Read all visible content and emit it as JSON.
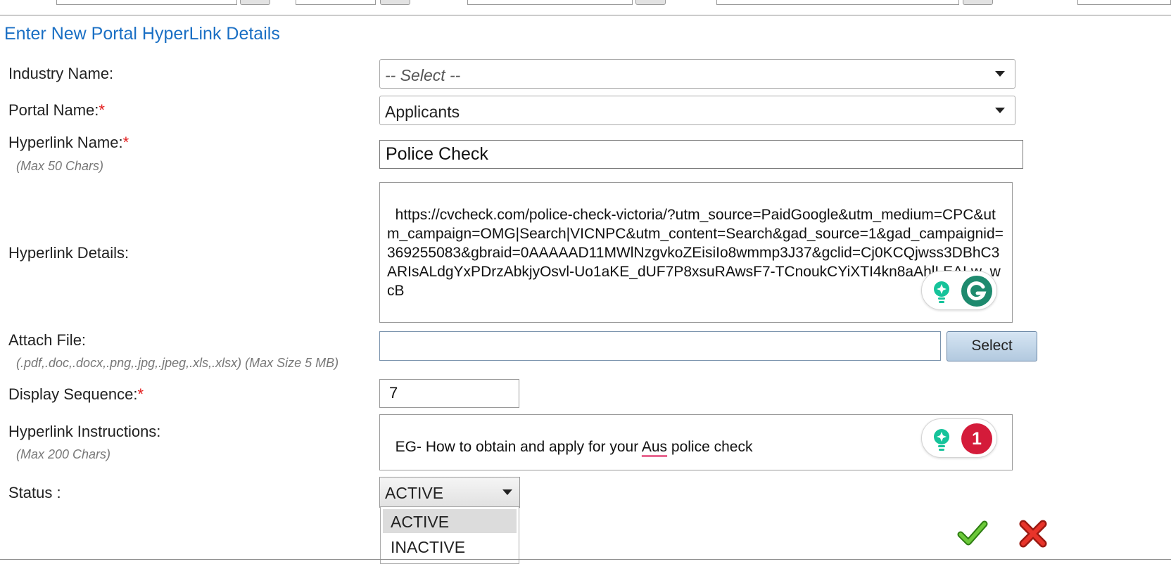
{
  "form": {
    "title": "Enter New Portal HyperLink Details",
    "required_marker": "*",
    "industry": {
      "label": "Industry Name:",
      "value": "-- Select --"
    },
    "portal": {
      "label": "Portal Name:",
      "value": "Applicants"
    },
    "hyperlink_name": {
      "label": "Hyperlink Name:",
      "note": "(Max 50 Chars)",
      "value": "Police Check"
    },
    "hyperlink_details": {
      "label": "Hyperlink Details:",
      "value": "https://cvcheck.com/police-check-victoria/?utm_source=PaidGoogle&utm_medium=CPC&utm_campaign=OMG|Search|VICNPC&utm_content=Search&gad_source=1&gad_campaignid=369255083&gbraid=0AAAAAD11MWlNzgvkoZEisiIo8wmmp3J37&gclid=Cj0KCQjwss3DBhC3ARIsALdgYxPDrzAbkjyOsvl-Uo1aKE_dUF7P8xsuRAwsF7-TCnoukCYiXTI4kn8aAhlLEALw_wcB"
    },
    "attach_file": {
      "label": "Attach File:",
      "note": "(.pdf,.doc,.docx,.png,.jpg,.jpeg,.xls,.xlsx) (Max Size 5 MB)",
      "button_label": "Select"
    },
    "display_sequence": {
      "label": "Display Sequence:",
      "value": "7"
    },
    "instructions": {
      "label": "Hyperlink Instructions:",
      "note": "(Max 200 Chars)",
      "text_before": "EG- How to obtain and apply for your ",
      "text_flagged": "Aus",
      "text_after": " police check"
    },
    "status": {
      "label": "Status :",
      "value": "ACTIVE",
      "options": [
        "ACTIVE",
        "INACTIVE"
      ]
    }
  },
  "grammarly": {
    "issue_count": "1"
  },
  "icons": {
    "save": "checkmark-icon",
    "cancel": "close-x-icon",
    "grammarly_bulb": "lightbulb-icon",
    "grammarly_logo": "grammarly-icon"
  },
  "colors": {
    "title": "#1a6fc4",
    "required": "#e31b1b",
    "grammarly_green": "#15c39a",
    "grammarly_alert": "#d41b3a",
    "save_green": "#4caf22",
    "cancel_red": "#d9261c"
  }
}
